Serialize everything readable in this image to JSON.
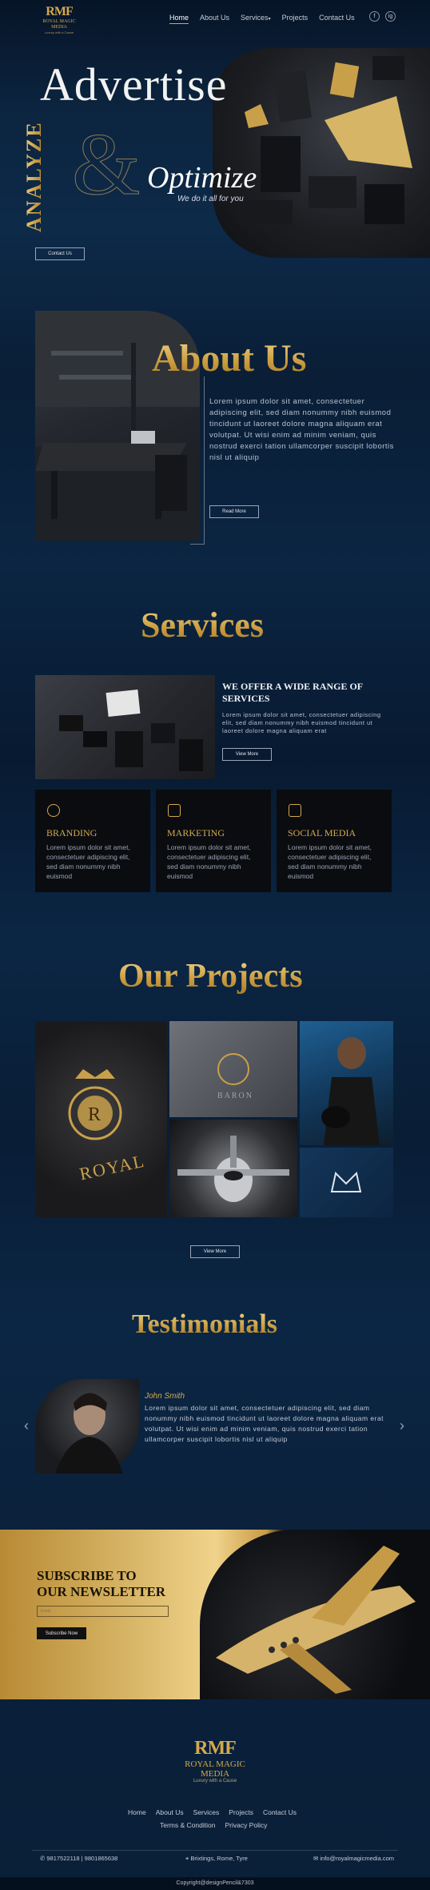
{
  "header": {
    "logo_mark": "RMF",
    "logo_title": "ROYAL MAGIC MEDIA",
    "logo_sub": "Luxury with a Cause",
    "nav": [
      "Home",
      "About Us",
      "Services",
      "Projects",
      "Contact Us"
    ],
    "services_caret": "▾",
    "social": [
      "f",
      "ig"
    ]
  },
  "hero": {
    "headline": "Advertise",
    "vertical": "ANALYZE",
    "amp": "&",
    "optimize": "Optimize",
    "tagline": "We do it all for you",
    "button": "Contact Us"
  },
  "about": {
    "title": "About Us",
    "text": "Lorem ipsum dolor sit amet, consectetuer adipiscing elit, sed diam nonummy nibh euismod tincidunt ut laoreet dolore magna aliquam erat volutpat. Ut wisi enim ad minim veniam, quis nostrud exerci tation ullamcorper suscipit lobortis nisl ut aliquip",
    "button": "Read More"
  },
  "services": {
    "title": "Services",
    "offer_title": "WE OFFER A WIDE RANGE OF SERVICES",
    "offer_text": "Lorem ipsum dolor sit amet, consectetuer adipiscing elit, sed diam nonummy nibh euismod tincidunt ut laoreet dolore magna aliquam erat",
    "button": "View More",
    "cards": [
      {
        "title": "BRANDING",
        "text": "Lorem ipsum dolor sit amet, consectetuer adipiscing elit, sed diam nonummy nibh euismod"
      },
      {
        "title": "MARKETING",
        "text": "Lorem ipsum dolor sit amet, consectetuer adipiscing elit, sed diam nonummy nibh euismod"
      },
      {
        "title": "SOCIAL MEDIA",
        "text": "Lorem ipsum dolor sit amet, consectetuer adipiscing elit, sed diam nonummy nibh euismod"
      }
    ]
  },
  "projects": {
    "title": "Our Projects",
    "royal_text": "ROYAL",
    "baron_text": "BARON",
    "button": "View More"
  },
  "testimonials": {
    "title": "Testimonials",
    "name": "John Smith",
    "text": "Lorem ipsum dolor sit amet, consectetuer adipiscing elit, sed diam nonummy nibh euismod tincidunt ut laoreet dolore magna aliquam erat volutpat. Ut wisi enim ad minim veniam, quis nostrud exerci tation ullamcorper suscipit lobortis nisl ut aliquip",
    "prev": "‹",
    "next": "›"
  },
  "newsletter": {
    "title_line1": "SUBSCRIBE TO",
    "title_line2": "OUR NEWSLETTER",
    "email_placeholder": "Email",
    "button": "Subscribe Now"
  },
  "footer": {
    "logo_mark": "RMF",
    "logo_title_1": "ROYAL MAGIC",
    "logo_title_2": "MEDIA",
    "logo_sub": "Luxury with a Cause",
    "nav": [
      "Home",
      "About Us",
      "Services",
      "Projects",
      "Contact Us"
    ],
    "nav2": [
      "Terms & Condition",
      "Privacy Policy"
    ],
    "phone": "9817522118 | 9801865638",
    "address": "Brixtings, Rome, Tyre",
    "email": "info@royalmagicmedia.com",
    "copyright": "Copyright@designPencil&7303"
  },
  "colors": {
    "gold": "#d4a94e",
    "navy": "#0b2542"
  }
}
